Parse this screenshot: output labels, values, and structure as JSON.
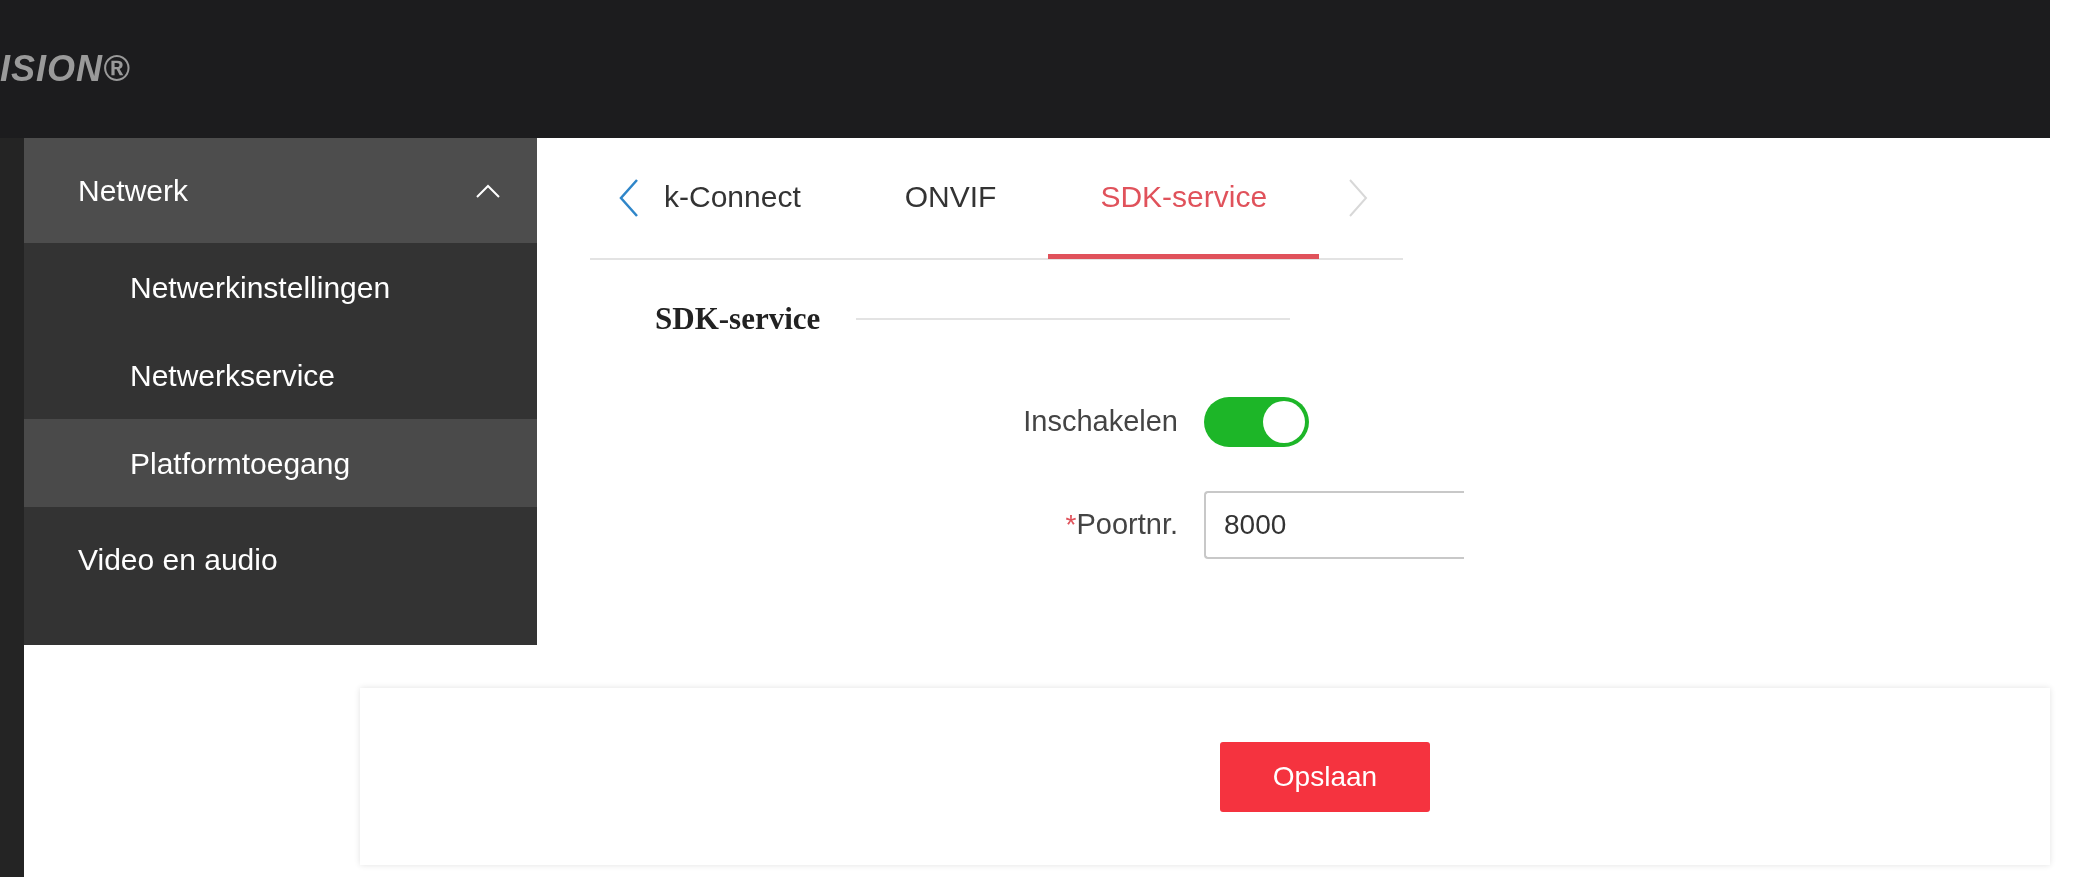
{
  "header": {
    "logo": "ISION®"
  },
  "menu": [
    {
      "label": "Netwerk",
      "expanded": true,
      "children": [
        {
          "label": "Netwerkinstellingen",
          "selected": false
        },
        {
          "label": "Netwerkservice",
          "selected": false
        },
        {
          "label": "Platformtoegang",
          "selected": true
        }
      ]
    },
    {
      "label": "Video en audio",
      "expanded": false
    }
  ],
  "tabs": [
    {
      "label": "k-Connect",
      "selected": false
    },
    {
      "label": "ONVIF",
      "selected": false
    },
    {
      "label": "SDK-service",
      "selected": true
    }
  ],
  "section": {
    "title": "SDK-service"
  },
  "form": [
    {
      "kind": "toggle",
      "label": "Inschakelen",
      "on": true
    },
    {
      "kind": "input",
      "label": "Poortnr.",
      "required_mark": "*",
      "value": "8000"
    }
  ],
  "buttons": [
    {
      "label": "Opslaan"
    }
  ]
}
